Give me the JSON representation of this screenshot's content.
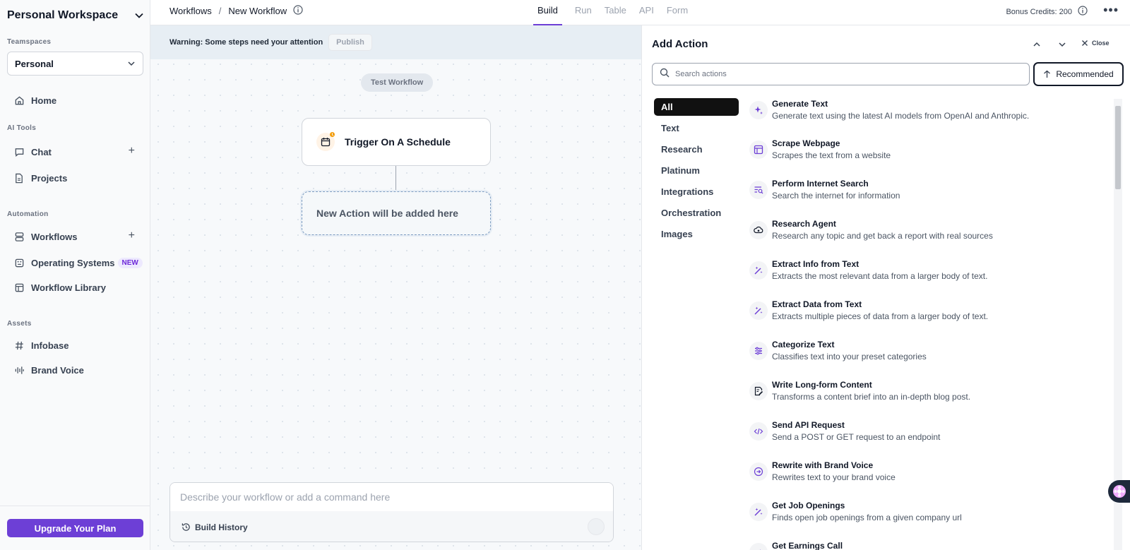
{
  "sidebar": {
    "workspace_title": "Personal Workspace",
    "teamspaces_label": "Teamspaces",
    "teamspace_value": "Personal",
    "home": "Home",
    "ai_tools_label": "AI Tools",
    "chat": "Chat",
    "projects": "Projects",
    "automation_label": "Automation",
    "workflows": "Workflows",
    "operating_systems": "Operating Systems",
    "new_badge": "NEW",
    "workflow_library": "Workflow Library",
    "assets_label": "Assets",
    "infobase": "Infobase",
    "brand_voice": "Brand Voice",
    "upgrade": "Upgrade Your Plan"
  },
  "header": {
    "breadcrumb_root": "Workflows",
    "breadcrumb_sep": "/",
    "breadcrumb_current": "New Workflow",
    "tabs": [
      "Build",
      "Run",
      "Table",
      "API",
      "Form"
    ],
    "active_tab": "Build",
    "credits": "Bonus Credits: 200",
    "more": "•••"
  },
  "canvas": {
    "warning": "Warning: Some steps need your attention",
    "publish": "Publish",
    "test_workflow": "Test Workflow",
    "trigger": "Trigger On A Schedule",
    "new_action": "New Action will be added here",
    "command_placeholder": "Describe your workflow or add a command here",
    "build_history": "Build History"
  },
  "panel": {
    "title": "Add Action",
    "close": "Close",
    "search_placeholder": "Search actions",
    "recommended": "Recommended",
    "categories": [
      "All",
      "Text",
      "Research",
      "Platinum",
      "Integrations",
      "Orchestration",
      "Images"
    ],
    "active_category": "All",
    "actions": [
      {
        "title": "Generate Text",
        "desc": "Generate text using the latest AI models from OpenAI and Anthropic.",
        "icon": "sparkle-icon"
      },
      {
        "title": "Scrape Webpage",
        "desc": "Scrapes the text from a website",
        "icon": "layout-icon"
      },
      {
        "title": "Perform Internet Search",
        "desc": "Search the internet for information",
        "icon": "text-search-icon"
      },
      {
        "title": "Research Agent",
        "desc": "Research any topic and get back a report with real sources",
        "icon": "eye-cloud-icon"
      },
      {
        "title": "Extract Info from Text",
        "desc": "Extracts the most relevant data from a larger body of text.",
        "icon": "magic-wand-icon"
      },
      {
        "title": "Extract Data from Text",
        "desc": "Extracts multiple pieces of data from a larger body of text.",
        "icon": "magic-wand-icon"
      },
      {
        "title": "Categorize Text",
        "desc": "Classifies text into your preset categories",
        "icon": "sliders-icon"
      },
      {
        "title": "Write Long-form Content",
        "desc": "Transforms a content brief into an in-depth blog post.",
        "icon": "document-pen-icon"
      },
      {
        "title": "Send API Request",
        "desc": "Send a POST or GET request to an endpoint",
        "icon": "code-icon"
      },
      {
        "title": "Rewrite with Brand Voice",
        "desc": "Rewrites text to your brand voice",
        "icon": "voice-circle-icon"
      },
      {
        "title": "Get Job Openings",
        "desc": "Finds open job openings from a given company url",
        "icon": "magic-wand-icon"
      },
      {
        "title": "Get Earnings Call",
        "desc": "",
        "icon": "magic-wand-icon"
      }
    ]
  },
  "colors": {
    "accent": "#6d3fd6",
    "icon_purple": "#6d3fd6",
    "warning_bg": "#e7eef4"
  }
}
